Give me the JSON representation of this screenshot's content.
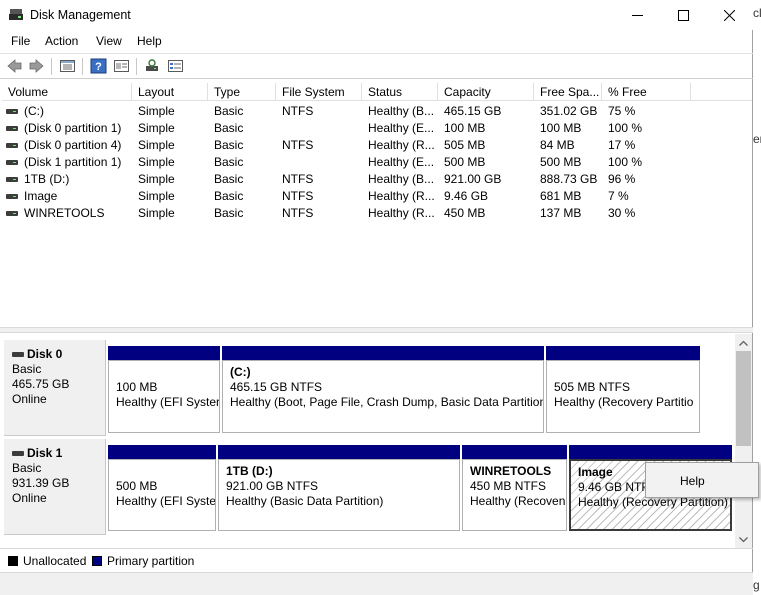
{
  "window": {
    "title": "Disk Management"
  },
  "menu": [
    "File",
    "Action",
    "View",
    "Help"
  ],
  "toolbar": {
    "icons": [
      "back-arrow-icon",
      "forward-arrow-icon",
      "list-view-icon",
      "help-icon",
      "properties-icon",
      "refresh-disks-icon",
      "rescan-icon"
    ]
  },
  "volume_list": {
    "columns": [
      "Volume",
      "Layout",
      "Type",
      "File System",
      "Status",
      "Capacity",
      "Free Spa...",
      "% Free"
    ],
    "rows": [
      {
        "volume": " (C:)",
        "layout": "Simple",
        "type": "Basic",
        "fs": "NTFS",
        "status": "Healthy (B...",
        "capacity": "465.15 GB",
        "free": "351.02 GB",
        "pct": "75 %"
      },
      {
        "volume": "(Disk 0 partition 1)",
        "layout": "Simple",
        "type": "Basic",
        "fs": "",
        "status": "Healthy (E...",
        "capacity": "100 MB",
        "free": "100 MB",
        "pct": "100 %"
      },
      {
        "volume": "(Disk 0 partition 4)",
        "layout": "Simple",
        "type": "Basic",
        "fs": "NTFS",
        "status": "Healthy (R...",
        "capacity": "505 MB",
        "free": "84 MB",
        "pct": "17 %"
      },
      {
        "volume": "(Disk 1 partition 1)",
        "layout": "Simple",
        "type": "Basic",
        "fs": "",
        "status": "Healthy (E...",
        "capacity": "500 MB",
        "free": "500 MB",
        "pct": "100 %"
      },
      {
        "volume": "1TB (D:)",
        "layout": "Simple",
        "type": "Basic",
        "fs": "NTFS",
        "status": "Healthy (B...",
        "capacity": "921.00 GB",
        "free": "888.73 GB",
        "pct": "96 %"
      },
      {
        "volume": "Image",
        "layout": "Simple",
        "type": "Basic",
        "fs": "NTFS",
        "status": "Healthy (R...",
        "capacity": "9.46 GB",
        "free": "681 MB",
        "pct": "7 %"
      },
      {
        "volume": "WINRETOOLS",
        "layout": "Simple",
        "type": "Basic",
        "fs": "NTFS",
        "status": "Healthy (R...",
        "capacity": "450 MB",
        "free": "137 MB",
        "pct": "30 %"
      }
    ]
  },
  "disks": [
    {
      "name": "Disk 0",
      "type": "Basic",
      "size": "465.75 GB",
      "state": "Online",
      "partitions": [
        {
          "name": "",
          "size": "100 MB",
          "status": "Healthy (EFI Syster"
        },
        {
          "name": "(C:)",
          "size": "465.15 GB NTFS",
          "status": "Healthy (Boot, Page File, Crash Dump, Basic Data Partition)"
        },
        {
          "name": "",
          "size": "505 MB NTFS",
          "status": "Healthy (Recovery Partitio"
        }
      ]
    },
    {
      "name": "Disk 1",
      "type": "Basic",
      "size": "931.39 GB",
      "state": "Online",
      "partitions": [
        {
          "name": "",
          "size": "500 MB",
          "status": "Healthy (EFI Syste"
        },
        {
          "name": "1TB  (D:)",
          "size": "921.00 GB NTFS",
          "status": "Healthy (Basic Data Partition)"
        },
        {
          "name": "WINRETOOLS",
          "size": "450 MB NTFS",
          "status": "Healthy (Recoven"
        },
        {
          "name": "Image",
          "size": "9.46 GB NTFS",
          "status": "Healthy (Recovery Partition)"
        }
      ]
    }
  ],
  "legend": {
    "unallocated": "Unallocated",
    "primary": "Primary partition"
  },
  "context_menu": {
    "items": [
      "Help"
    ]
  },
  "colors": {
    "primary_partition": "#000080",
    "unallocated": "#000000"
  }
}
